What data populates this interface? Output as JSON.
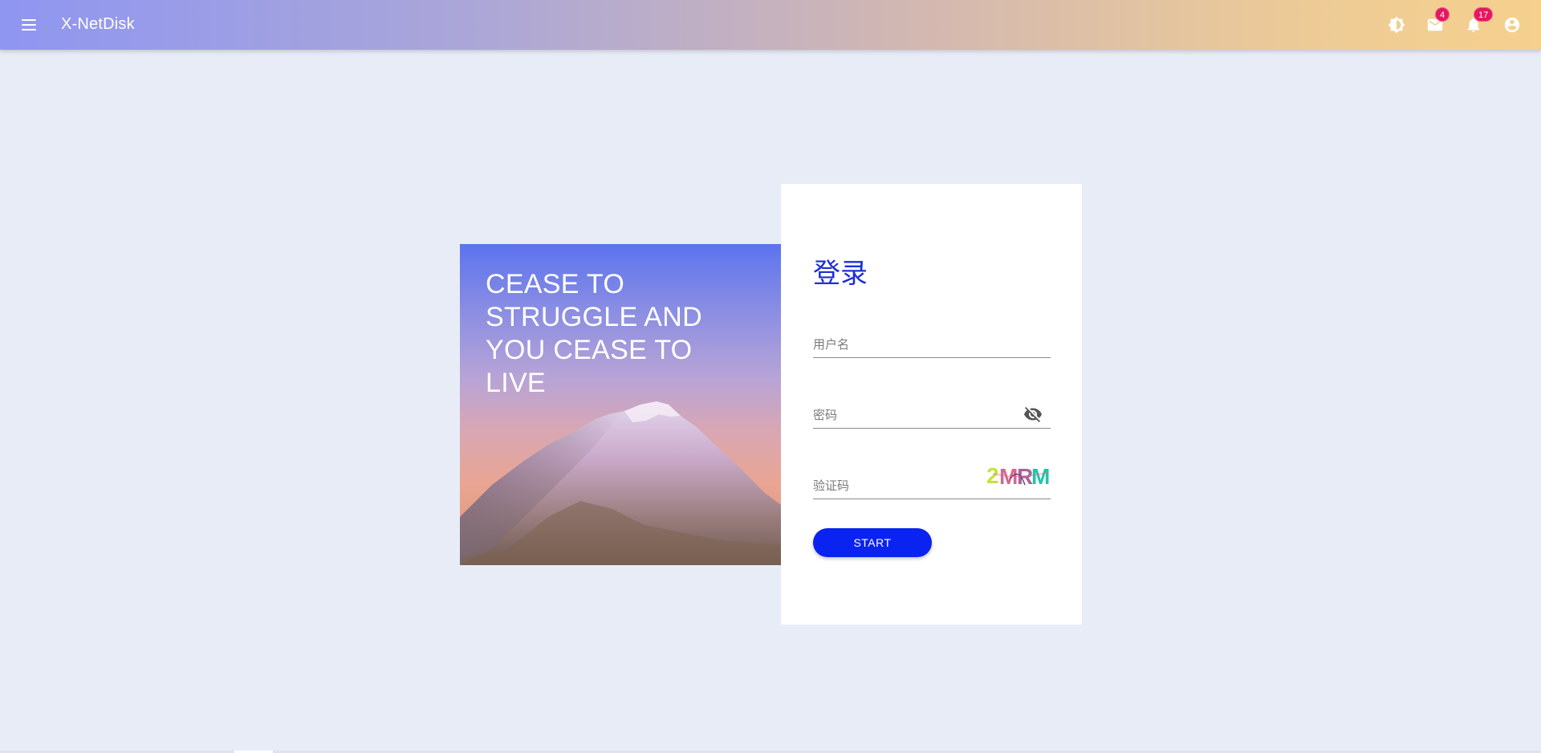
{
  "appbar": {
    "title": "X-NetDisk",
    "icons": {
      "menu": "menu-icon",
      "theme": "brightness-icon",
      "mail": "mail-icon",
      "notifications": "bell-icon",
      "account": "account-circle-icon"
    },
    "mail_badge": "4",
    "notification_badge": "17",
    "gradient_colors": [
      "#8f96f1",
      "#f5d08e"
    ]
  },
  "hero": {
    "quote": "CEASE TO STRUGGLE AND YOU CEASE TO LIVE"
  },
  "login": {
    "title": "登录",
    "username_placeholder": "用户名",
    "password_placeholder": "密码",
    "captcha_placeholder": "验证码",
    "captcha_text": "2MRM",
    "start_label": "START",
    "password_toggle_icon": "eye-off-icon"
  },
  "colors": {
    "page_background": "#e8ecf7",
    "accent": "#0a23f0",
    "title": "#1d2fd6",
    "badge": "#e5175f"
  }
}
